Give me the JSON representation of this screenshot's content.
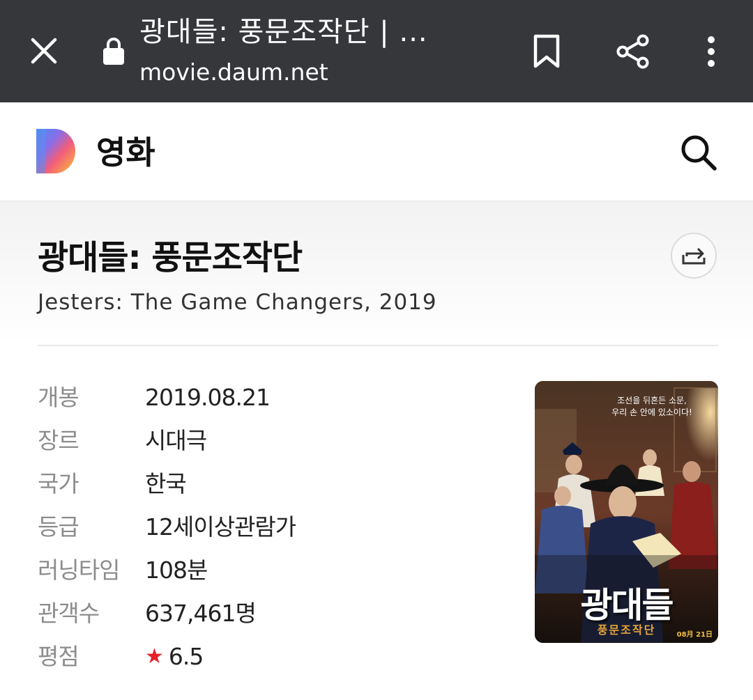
{
  "browser": {
    "page_title": "광대들: 풍문조작단 | ...",
    "url": "movie.daum.net",
    "icons": [
      "close-icon",
      "lock-icon",
      "bookmark-icon",
      "share-icon",
      "more-vertical-icon"
    ]
  },
  "site_header": {
    "logo": "daum-logo",
    "section_title": "영화",
    "search_icon": "search-icon"
  },
  "movie": {
    "title": "광대들: 풍문조작단",
    "subtitle": "Jesters: The Game Changers, 2019",
    "share_icon": "share-arrow-icon",
    "info": [
      {
        "label": "개봉",
        "value": "2019.08.21"
      },
      {
        "label": "장르",
        "value": "시대극"
      },
      {
        "label": "국가",
        "value": "한국"
      },
      {
        "label": "등급",
        "value": "12세이상관람가"
      },
      {
        "label": "러닝타임",
        "value": "108분"
      },
      {
        "label": "관객수",
        "value": "637,461명"
      },
      {
        "label": "평점",
        "value": "6.5",
        "icon": "star-icon"
      }
    ],
    "poster": {
      "title": "광대들",
      "subtitle": "풍문조작단",
      "tagline_1": "조선을 뒤흔든 소문,",
      "tagline_2": "우리 손 안에 있소이다!",
      "release_text": "08月 21日"
    }
  },
  "colors": {
    "topbar_bg": "#35373b",
    "star": "#e8202a",
    "label_gray": "#8c8c8c"
  }
}
